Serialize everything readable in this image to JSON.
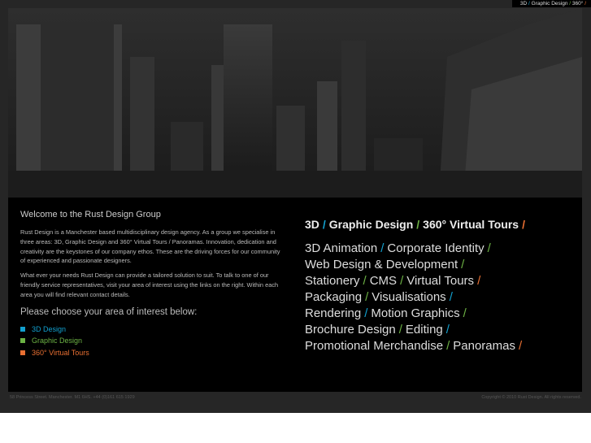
{
  "topnav": {
    "items": [
      "3D",
      "Graphic Design",
      "360°"
    ]
  },
  "colors": {
    "blue": "#12a0cf",
    "green": "#6cb244",
    "orange": "#e86f32"
  },
  "intro": {
    "title": "Welcome to the Rust Design Group",
    "p1": "Rust Design is a Manchester based multidisciplinary design agency. As a group we specialise in three areas: 3D, Graphic Design and 360° Virtual Tours / Panoramas. Innovation, dedication and creativity are the keystones of our company ethos. These are the driving forces for our community of experienced and passionate designers.",
    "p2": "What ever your needs Rust Design can provide a tailored solution to suit. To talk to one of our friendly service representatives, visit your area of interest using the links on the right. Within each area you will find relevant contact details.",
    "choose": "Please choose your area of interest below:",
    "areas": [
      "3D Design",
      "Graphic Design",
      "360° Virtual Tours"
    ]
  },
  "services": {
    "heading": [
      "3D",
      "Graphic Design",
      "360° Virtual Tours"
    ],
    "lines": [
      [
        "3D Animation",
        "Corporate Identity"
      ],
      [
        "Web Design & Development"
      ],
      [
        "Stationery",
        "CMS",
        "Virtual Tours"
      ],
      [
        "Packaging",
        "Visualisations"
      ],
      [
        "Rendering",
        "Motion Graphics"
      ],
      [
        "Brochure Design",
        "Editing"
      ],
      [
        "Promotional Merchandise",
        "Panoramas"
      ]
    ],
    "slash": "/"
  },
  "footer": {
    "address": "58 Princess Street. Manchester. M1 6HS. +44 (0)161 615 1929",
    "copyright": "Copyright © 2010 Rust Design. All rights reserved."
  }
}
